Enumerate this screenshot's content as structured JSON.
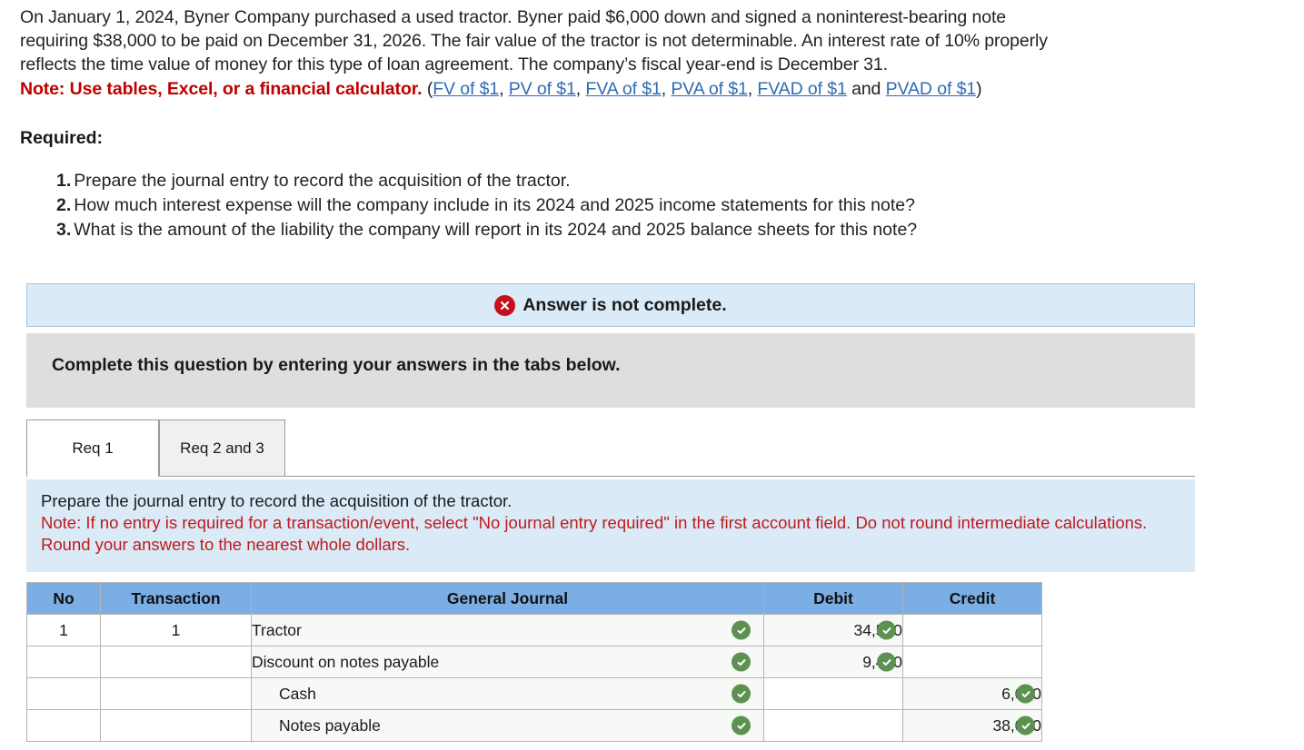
{
  "problem": {
    "line1": "On January 1, 2024, Byner Company purchased a used tractor. Byner paid $6,000 down and signed a noninterest-bearing note",
    "line2": "requiring $38,000 to be paid on December 31, 2026. The fair value of the tractor is not determinable. An interest rate of 10% properly",
    "line3": "reflects the time value of money for this type of loan agreement. The company’s fiscal year-end is December 31.",
    "note_label": "Note: Use tables, Excel, or a financial calculator.",
    "paren_open": " (",
    "paren_close": ")",
    "sep": ", ",
    "and": " and ",
    "links": [
      "FV of $1",
      "PV of $1",
      "FVA of $1",
      "PVA of $1",
      "FVAD of $1",
      "PVAD of $1"
    ]
  },
  "required": {
    "heading": "Required:",
    "items": [
      {
        "num": "1.",
        "text": "Prepare the journal entry to record the acquisition of the tractor."
      },
      {
        "num": "2.",
        "text": "How much interest expense will the company include in its 2024 and 2025 income statements for this note?"
      },
      {
        "num": "3.",
        "text": "What is the amount of the liability the company will report in its 2024 and 2025 balance sheets for this note?"
      }
    ]
  },
  "banners": {
    "answer_status": "Answer is not complete.",
    "status_icon": "error-x-icon",
    "complete_instruction": "Complete this question by entering your answers in the tabs below."
  },
  "tabs": [
    {
      "label": "Req 1",
      "active": true
    },
    {
      "label": "Req 2 and 3",
      "active": false
    }
  ],
  "instructions": {
    "line1": "Prepare the journal entry to record the acquisition of the tractor.",
    "note": "Note: If no entry is required for a transaction/event, select \"No journal entry required\" in the first account field. Do not round intermediate calculations. Round your answers to the nearest whole dollars."
  },
  "journal": {
    "headers": [
      "No",
      "Transaction",
      "General Journal",
      "Debit",
      "Credit"
    ],
    "rows": [
      {
        "no": "1",
        "transaction": "1",
        "account": "Tractor",
        "indent": false,
        "account_valid": true,
        "debit": "34,550",
        "debit_valid": true,
        "credit": "",
        "credit_valid": false
      },
      {
        "no": "",
        "transaction": "",
        "account": "Discount on notes payable",
        "indent": false,
        "account_valid": true,
        "debit": "9,450",
        "debit_valid": true,
        "credit": "",
        "credit_valid": false
      },
      {
        "no": "",
        "transaction": "",
        "account": "Cash",
        "indent": true,
        "account_valid": true,
        "debit": "",
        "debit_valid": false,
        "credit": "6,000",
        "credit_valid": true
      },
      {
        "no": "",
        "transaction": "",
        "account": "Notes payable",
        "indent": true,
        "account_valid": true,
        "debit": "",
        "debit_valid": false,
        "credit": "38,000",
        "credit_valid": true
      }
    ]
  },
  "colors": {
    "header_blue": "#7aaee4",
    "banner_blue": "#daeaf7",
    "banner_grey": "#dedede",
    "error_red": "#c9101a",
    "note_red": "#c01b1b",
    "valid_green": "#5c9152",
    "link_blue": "#2f6bb5"
  }
}
